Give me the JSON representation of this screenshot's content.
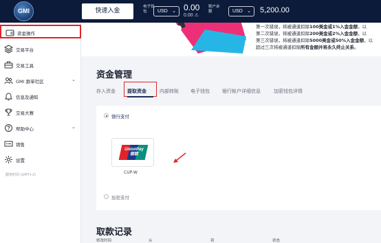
{
  "topbar": {
    "logo_text": "GMI",
    "deposit_button": "快速入金",
    "equity_label_1": "电子钱",
    "equity_label_2": "包",
    "currency_1": "USD",
    "equity_value": "0.00",
    "equity_sub": "0.00 ⚠",
    "account_label_1": "账户余",
    "account_label_2": "额",
    "currency_2": "USD",
    "balance": "5,200.00"
  },
  "sidebar": {
    "items": [
      {
        "label": "资金操作",
        "icon": "wallet-icon",
        "active": true
      },
      {
        "label": "交易平台",
        "icon": "layers-icon"
      },
      {
        "label": "交易工具",
        "icon": "toolbox-icon"
      },
      {
        "label": "GMI 跟单社区",
        "icon": "community-icon",
        "expandable": true
      },
      {
        "label": "信息及通知",
        "icon": "bell-icon"
      },
      {
        "label": "交易大赛",
        "icon": "trophy-icon"
      },
      {
        "label": "帮助中心",
        "icon": "help-icon",
        "expandable": true
      },
      {
        "label": "销售",
        "icon": "sales-icon"
      },
      {
        "label": "设置",
        "icon": "gear-icon"
      }
    ],
    "server_time": "服务时间 (GMT+2)"
  },
  "banner": {
    "lines": [
      {
        "pre": "第一次错误，将被通道扣除",
        "bold": "100美金或1%入金金额",
        "post": "，以"
      },
      {
        "pre": "第二次错误，将被通道扣除",
        "bold": "200美金或2%入金金额",
        "post": "，以"
      },
      {
        "pre": "第三次错误，将被通道扣除",
        "bold": "5000美金或50%入金金额",
        "post": "，以"
      },
      {
        "pre": "超过三次将被通道扣除",
        "bold": "所有金额并将永久终止关系",
        "post": "。"
      }
    ]
  },
  "main": {
    "title": "资金管理",
    "tabs": [
      {
        "label": "存入资金"
      },
      {
        "label": "提取资金",
        "active": true
      },
      {
        "label": "内部转账"
      },
      {
        "label": "电子钱包"
      },
      {
        "label": "银行帐户详细信息"
      },
      {
        "label": "加密钱包详情"
      }
    ],
    "payment_methods": {
      "bank": "银行支付",
      "crypto": "加密支付",
      "unionpay_logo_text_1": "UnionPay",
      "unionpay_logo_text_2": "银联",
      "unionpay_label": "CUP-W"
    },
    "records_title": "取款记录",
    "record_columns": [
      "修改时间",
      "从",
      "到",
      "状态"
    ]
  },
  "colors": {
    "topbar_bg": "#0c1b3a",
    "highlight_red": "#e0232a",
    "accent_navy": "#1d2a5a"
  }
}
